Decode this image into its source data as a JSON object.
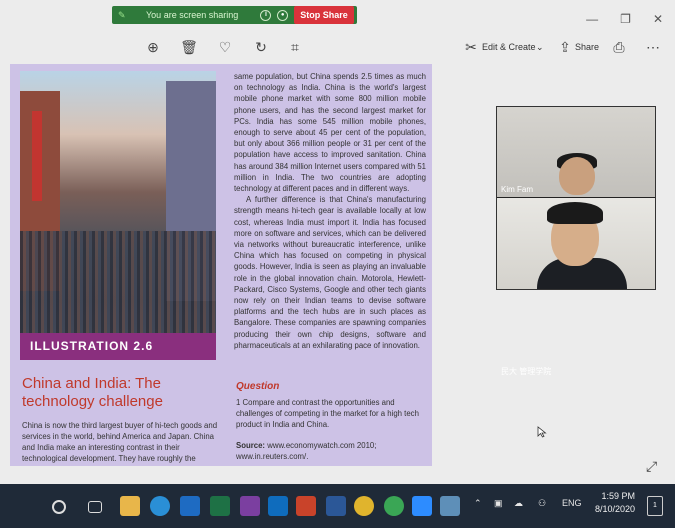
{
  "share_banner": {
    "text": "You are screen sharing",
    "stop_label": "Stop Share"
  },
  "window_controls": [
    "minimize-icon",
    "restore-icon",
    "close-icon"
  ],
  "toolbar": {
    "icons": [
      "zoom-in-icon",
      "delete-icon",
      "heart-icon",
      "rotate-icon",
      "crop-icon"
    ],
    "edit_create_label": "Edit & Create",
    "share_label": "Share",
    "print_icon": "print-icon",
    "more_icon": "more-icon"
  },
  "document": {
    "illustration_label": "ILLUSTRATION 2.6",
    "heading_line1": "China and India: The",
    "heading_line2": "technology challenge",
    "left_body": "China is now the third largest buyer of hi-tech goods and services in the world, behind America and Japan. China and India make an interesting contrast in their technological development. They have roughly the",
    "right_p1": "same population, but China spends 2.5 times as much on technology as India. China is the world's largest mobile phone market with some 800 million mobile phone users, and has the second largest market for PCs. India has some 545 million mobile phones, enough to serve about 45 per cent of the population, but only about 366 million people or 31 per cent of the population have access to improved sanitation. China has around 384 million Internet users compared with 51 million in India. The two countries are adopting technology at different paces and in different ways.",
    "right_p2": "A further difference is that China's manufacturing strength means hi-tech gear is available locally at low cost, whereas India must import it. India has focused more on software and services, which can be delivered via networks without bureaucratic interference, unlike China which has focused on competing in physical goods. However, India is seen as playing an invaluable role in the global innovation chain. Motorola, Hewlett-Packard, Cisco Systems, Google and other tech giants now rely on their Indian teams to devise software platforms and the tech hubs are in such places as Bangalore. These companies are spawning companies producing their own chip designs, software and pharmaceuticals at an exhilarating pace of innovation.",
    "question_title": "Question",
    "question_text": "1 Compare and contrast the opportunities and challenges of competing in the market for a high tech product in India and China.",
    "source_label": "Source:",
    "source_text": "www.economywatch.com 2010; www.in.reuters.com/."
  },
  "video": {
    "participant1": "Kim Fam",
    "participant2": "民大 管理学院"
  },
  "taskbar": {
    "apps": [
      "start-icon",
      "task-view-icon",
      "file-explorer-icon",
      "edge-icon",
      "store-icon",
      "excel-icon",
      "onenote-icon",
      "outlook-icon",
      "powerpoint-icon",
      "word-icon",
      "chrome-icon",
      "other-browser-icon",
      "zoom-icon",
      "photos-icon"
    ],
    "lang": "ENG",
    "time": "1:59 PM",
    "date": "8/10/2020",
    "notif_count": "1"
  },
  "colors": {
    "banner_green": "#2f7a3b",
    "stop_red": "#d9333b",
    "page_purple": "#cdc2e6",
    "label_magenta": "#8a2f7e",
    "heading_red": "#c0392b",
    "taskbar": "#1f2a38"
  }
}
